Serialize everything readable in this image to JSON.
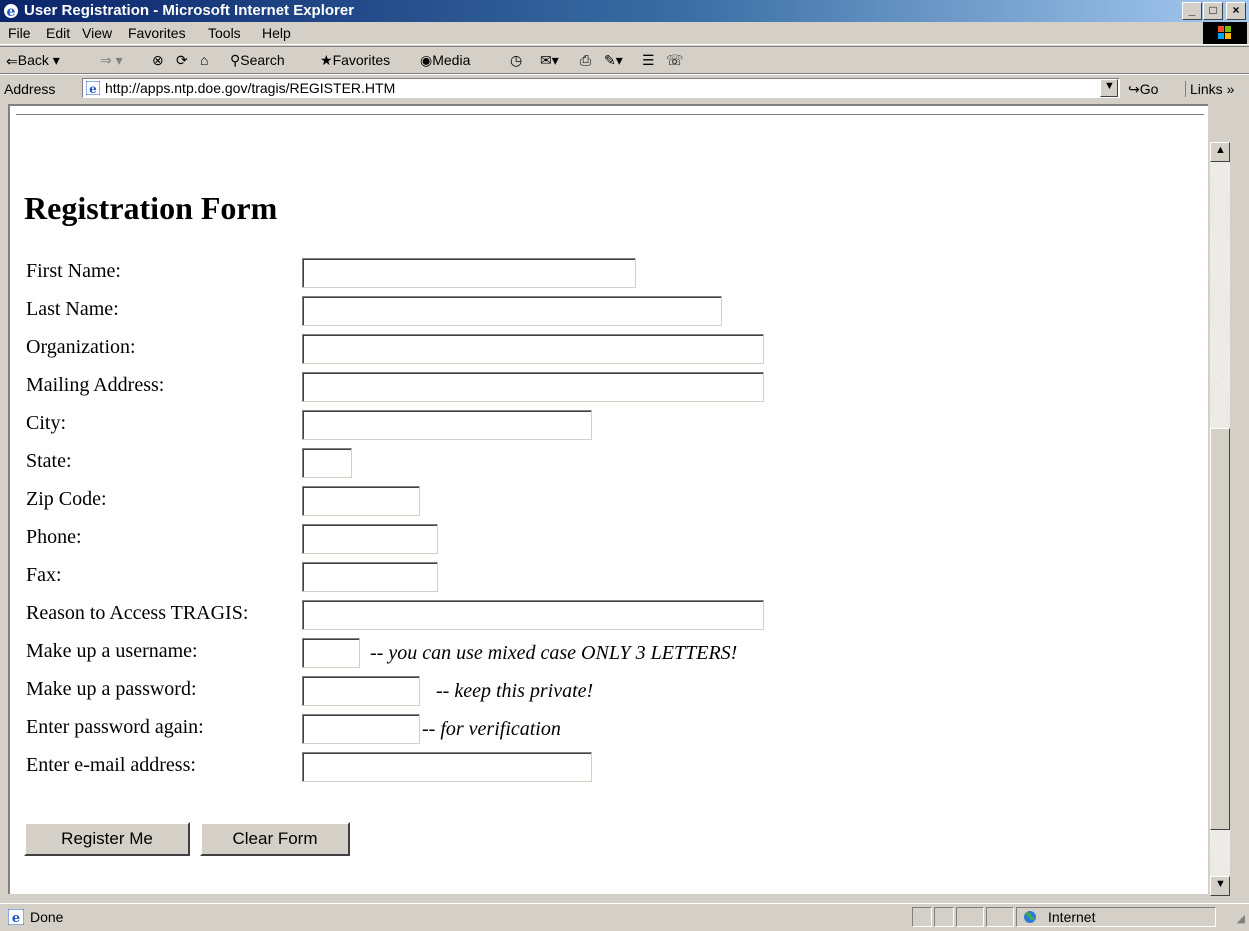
{
  "window": {
    "title": "User Registration - Microsoft Internet Explorer",
    "buttons": {
      "minimize": "_",
      "maximize": "□",
      "close": "×"
    }
  },
  "menu": [
    "File",
    "Edit",
    "View",
    "Favorites",
    "Tools",
    "Help"
  ],
  "toolbar": {
    "back": "Back",
    "search": "Search",
    "favorites": "Favorites",
    "media": "Media"
  },
  "address": {
    "label": "Address",
    "url": "http://apps.ntp.doe.gov/tragis/REGISTER.HTM",
    "go": "Go",
    "links": "Links"
  },
  "page": {
    "title": "Registration Form",
    "fields": [
      {
        "label": "First Name:",
        "value": ""
      },
      {
        "label": "Last Name:",
        "value": ""
      },
      {
        "label": "Organization:",
        "value": ""
      },
      {
        "label": "Mailing Address:",
        "value": ""
      },
      {
        "label": "City:",
        "value": ""
      },
      {
        "label": "State:",
        "value": ""
      },
      {
        "label": "Zip Code:",
        "value": ""
      },
      {
        "label": "Phone:",
        "value": ""
      },
      {
        "label": "Fax:",
        "value": ""
      },
      {
        "label": "Reason to Access TRAGIS:",
        "value": ""
      },
      {
        "label": "Make up a username:",
        "value": "",
        "note_dash": "--",
        "note": "you can use mixed case ONLY 3 LETTERS!"
      },
      {
        "label": "Make up a password:",
        "value": "",
        "note_dash": "--",
        "note": "keep this private!"
      },
      {
        "label": "Enter password again:",
        "value": "",
        "note_dash": "--",
        "note": "for verification"
      },
      {
        "label": "Enter e-mail address:",
        "value": ""
      }
    ],
    "buttons": {
      "register": "Register Me",
      "clear": "Clear Form"
    }
  },
  "status": {
    "text": "Done",
    "zone": "Internet"
  }
}
